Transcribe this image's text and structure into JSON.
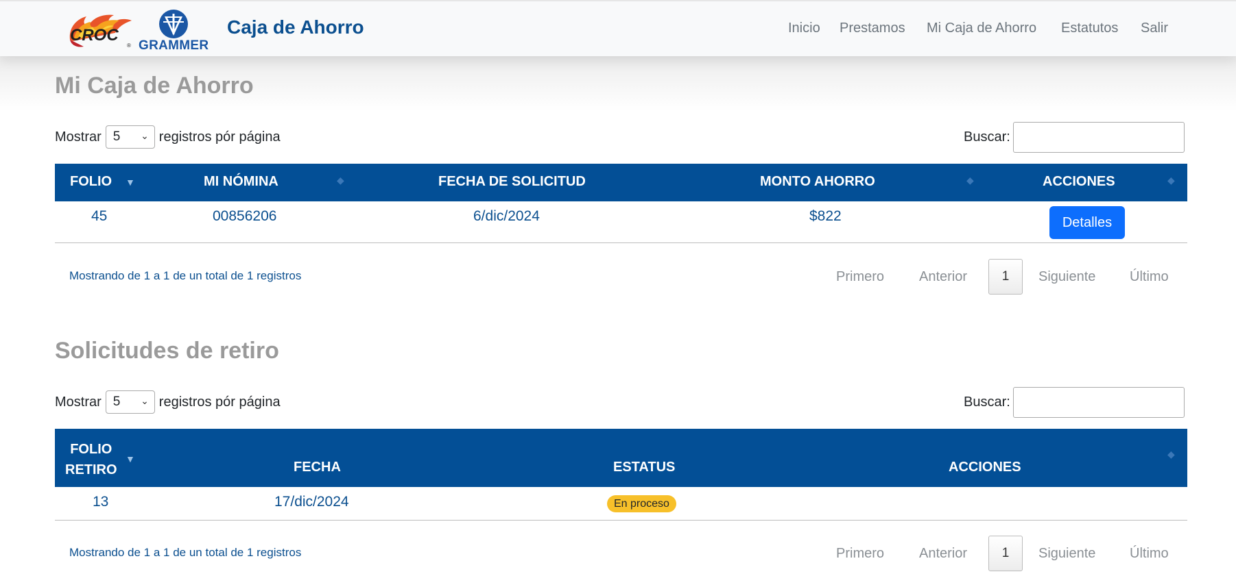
{
  "header": {
    "logo_croc_text": "CROC",
    "logo_croc_reg": "®",
    "logo_grammer_text": "GRAMMER",
    "brand_title": "Caja de Ahorro",
    "nav": [
      "Inicio",
      "Prestamos",
      "Mi Caja de Ahorro",
      "Estatutos",
      "Salir"
    ]
  },
  "savings": {
    "title": "Mi Caja de Ahorro",
    "length_label_prefix": "Mostrar",
    "length_value": "5",
    "length_label_suffix": "registros pór página",
    "search_label": "Buscar:",
    "search_value": "",
    "columns": [
      "FOLIO",
      "MI NÓMINA",
      "FECHA DE SOLICITUD",
      "MONTO AHORRO",
      "ACCIONES"
    ],
    "rows": [
      {
        "folio": "45",
        "nomina": "00856206",
        "fecha": "6/dic/2024",
        "monto": "$822",
        "action": "Detalles"
      }
    ],
    "info": "Mostrando de 1 a 1 de un total de 1 registros",
    "pagination": {
      "first": "Primero",
      "prev": "Anterior",
      "current": "1",
      "next": "Siguiente",
      "last": "Último"
    }
  },
  "withdrawals": {
    "title": "Solicitudes de retiro",
    "length_label_prefix": "Mostrar",
    "length_value": "5",
    "length_label_suffix": "registros pór página",
    "search_label": "Buscar:",
    "search_value": "",
    "columns": [
      "FOLIO RETIRO",
      "FECHA",
      "ESTATUS",
      "ACCIONES"
    ],
    "column0_line1": "FOLIO",
    "column0_line2": "RETIRO",
    "rows": [
      {
        "folio": "13",
        "fecha": "17/dic/2024",
        "estatus": "En proceso",
        "action": ""
      }
    ],
    "info": "Mostrando de 1 a 1 de un total de 1 registros",
    "pagination": {
      "first": "Primero",
      "prev": "Anterior",
      "current": "1",
      "next": "Siguiente",
      "last": "Último"
    }
  },
  "colors": {
    "table_header": "#034f96",
    "brand_blue": "#0b4f8f",
    "button_primary": "#0d6efd",
    "badge_warning": "#f7c02a",
    "title_gray": "#9a9a9a"
  },
  "icons": [
    "flame-logo-icon",
    "grammer-logo-icon",
    "chevron-down-icon",
    "sort-icon"
  ]
}
